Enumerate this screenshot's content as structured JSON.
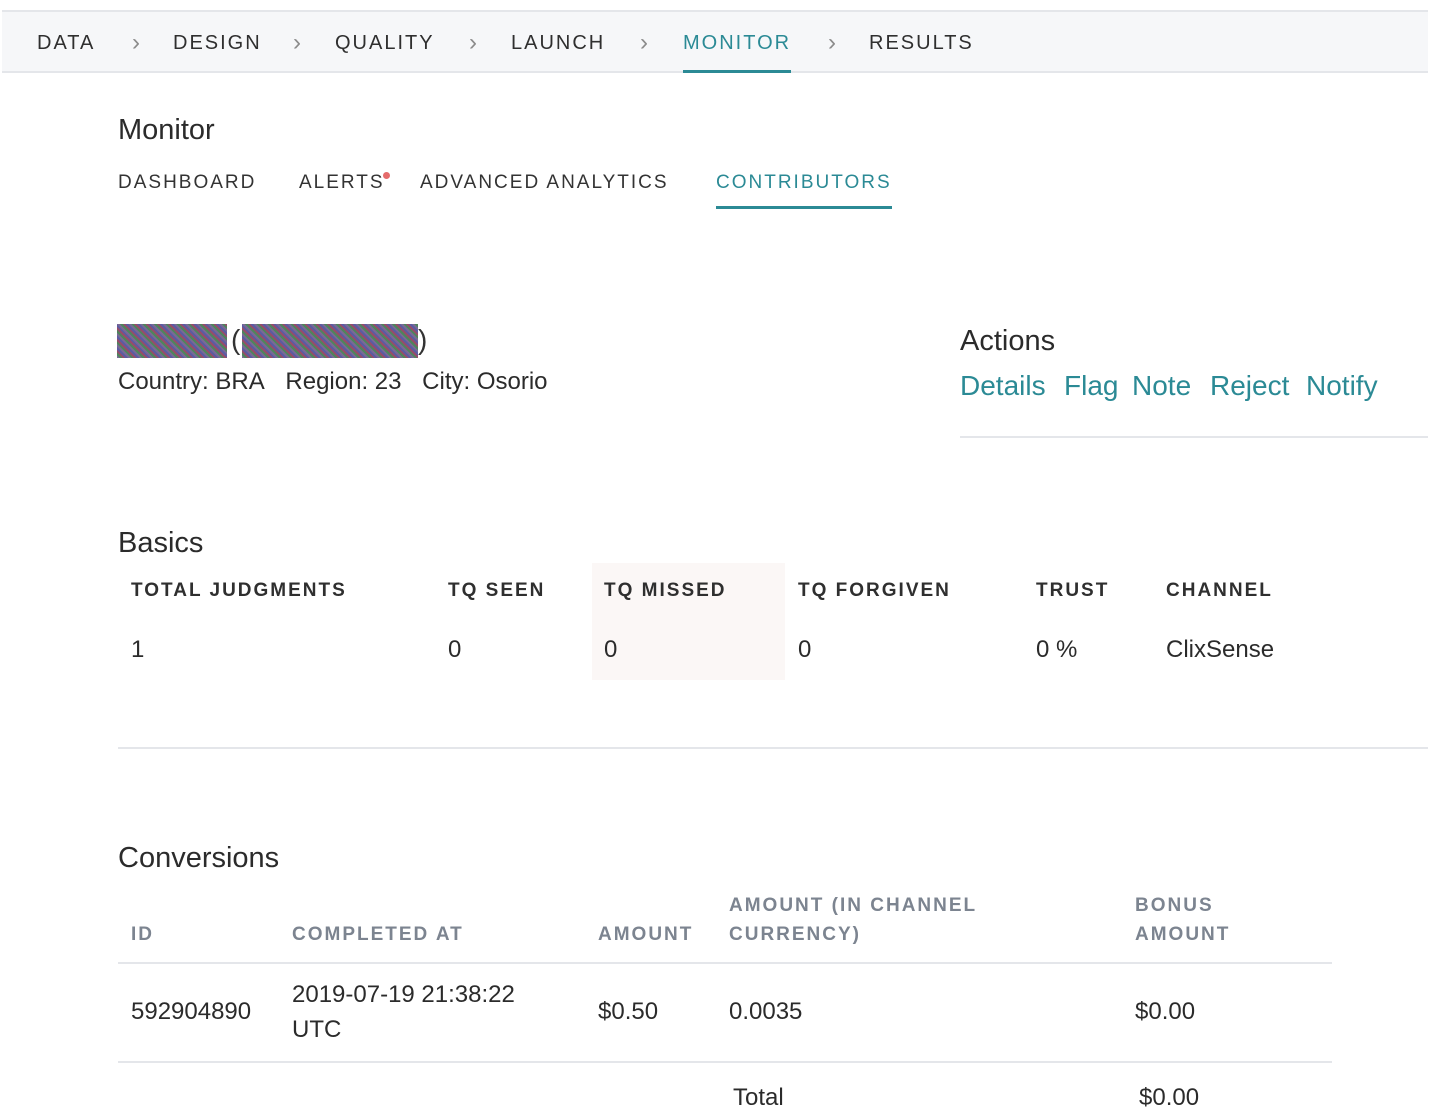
{
  "breadcrumb": [
    {
      "label": "DATA"
    },
    {
      "label": "DESIGN"
    },
    {
      "label": "QUALITY"
    },
    {
      "label": "LAUNCH"
    },
    {
      "label": "MONITOR"
    },
    {
      "label": "RESULTS"
    }
  ],
  "page": {
    "title": "Monitor"
  },
  "subtabs": [
    {
      "label": "DASHBOARD"
    },
    {
      "label": "ALERTS"
    },
    {
      "label": "ADVANCED ANALYTICS"
    },
    {
      "label": "CONTRIBUTORS"
    }
  ],
  "contributor": {
    "open_paren": "(",
    "close_paren": ")",
    "country": "Country: BRA",
    "region": "Region: 23",
    "city": "City: Osorio"
  },
  "actions": {
    "title": "Actions",
    "links": [
      "Details",
      "Flag",
      "Note",
      "Reject",
      "Notify"
    ]
  },
  "basics": {
    "title": "Basics",
    "headers": [
      "TOTAL JUDGMENTS",
      "TQ SEEN",
      "TQ MISSED",
      "TQ FORGIVEN",
      "TRUST",
      "CHANNEL"
    ],
    "values": [
      "1",
      "0",
      "0",
      "0",
      "0 %",
      "ClixSense"
    ]
  },
  "conversions": {
    "title": "Conversions",
    "headers": {
      "id": "ID",
      "completed_at": "COMPLETED AT",
      "amount": "AMOUNT",
      "amount_channel_1": "AMOUNT (IN CHANNEL",
      "amount_channel_2": "CURRENCY)",
      "bonus_1": "BONUS",
      "bonus_2": "AMOUNT"
    },
    "row": {
      "id": "592904890",
      "completed_at_1": "2019-07-19 21:38:22",
      "completed_at_2": "UTC",
      "amount": "$0.50",
      "amount_channel": "0.0035",
      "bonus": "$0.00"
    },
    "total": {
      "label": "Total",
      "value": "$0.00"
    }
  },
  "colors": {
    "accent": "#2b8a95",
    "alert_dot": "#e56b6b"
  }
}
